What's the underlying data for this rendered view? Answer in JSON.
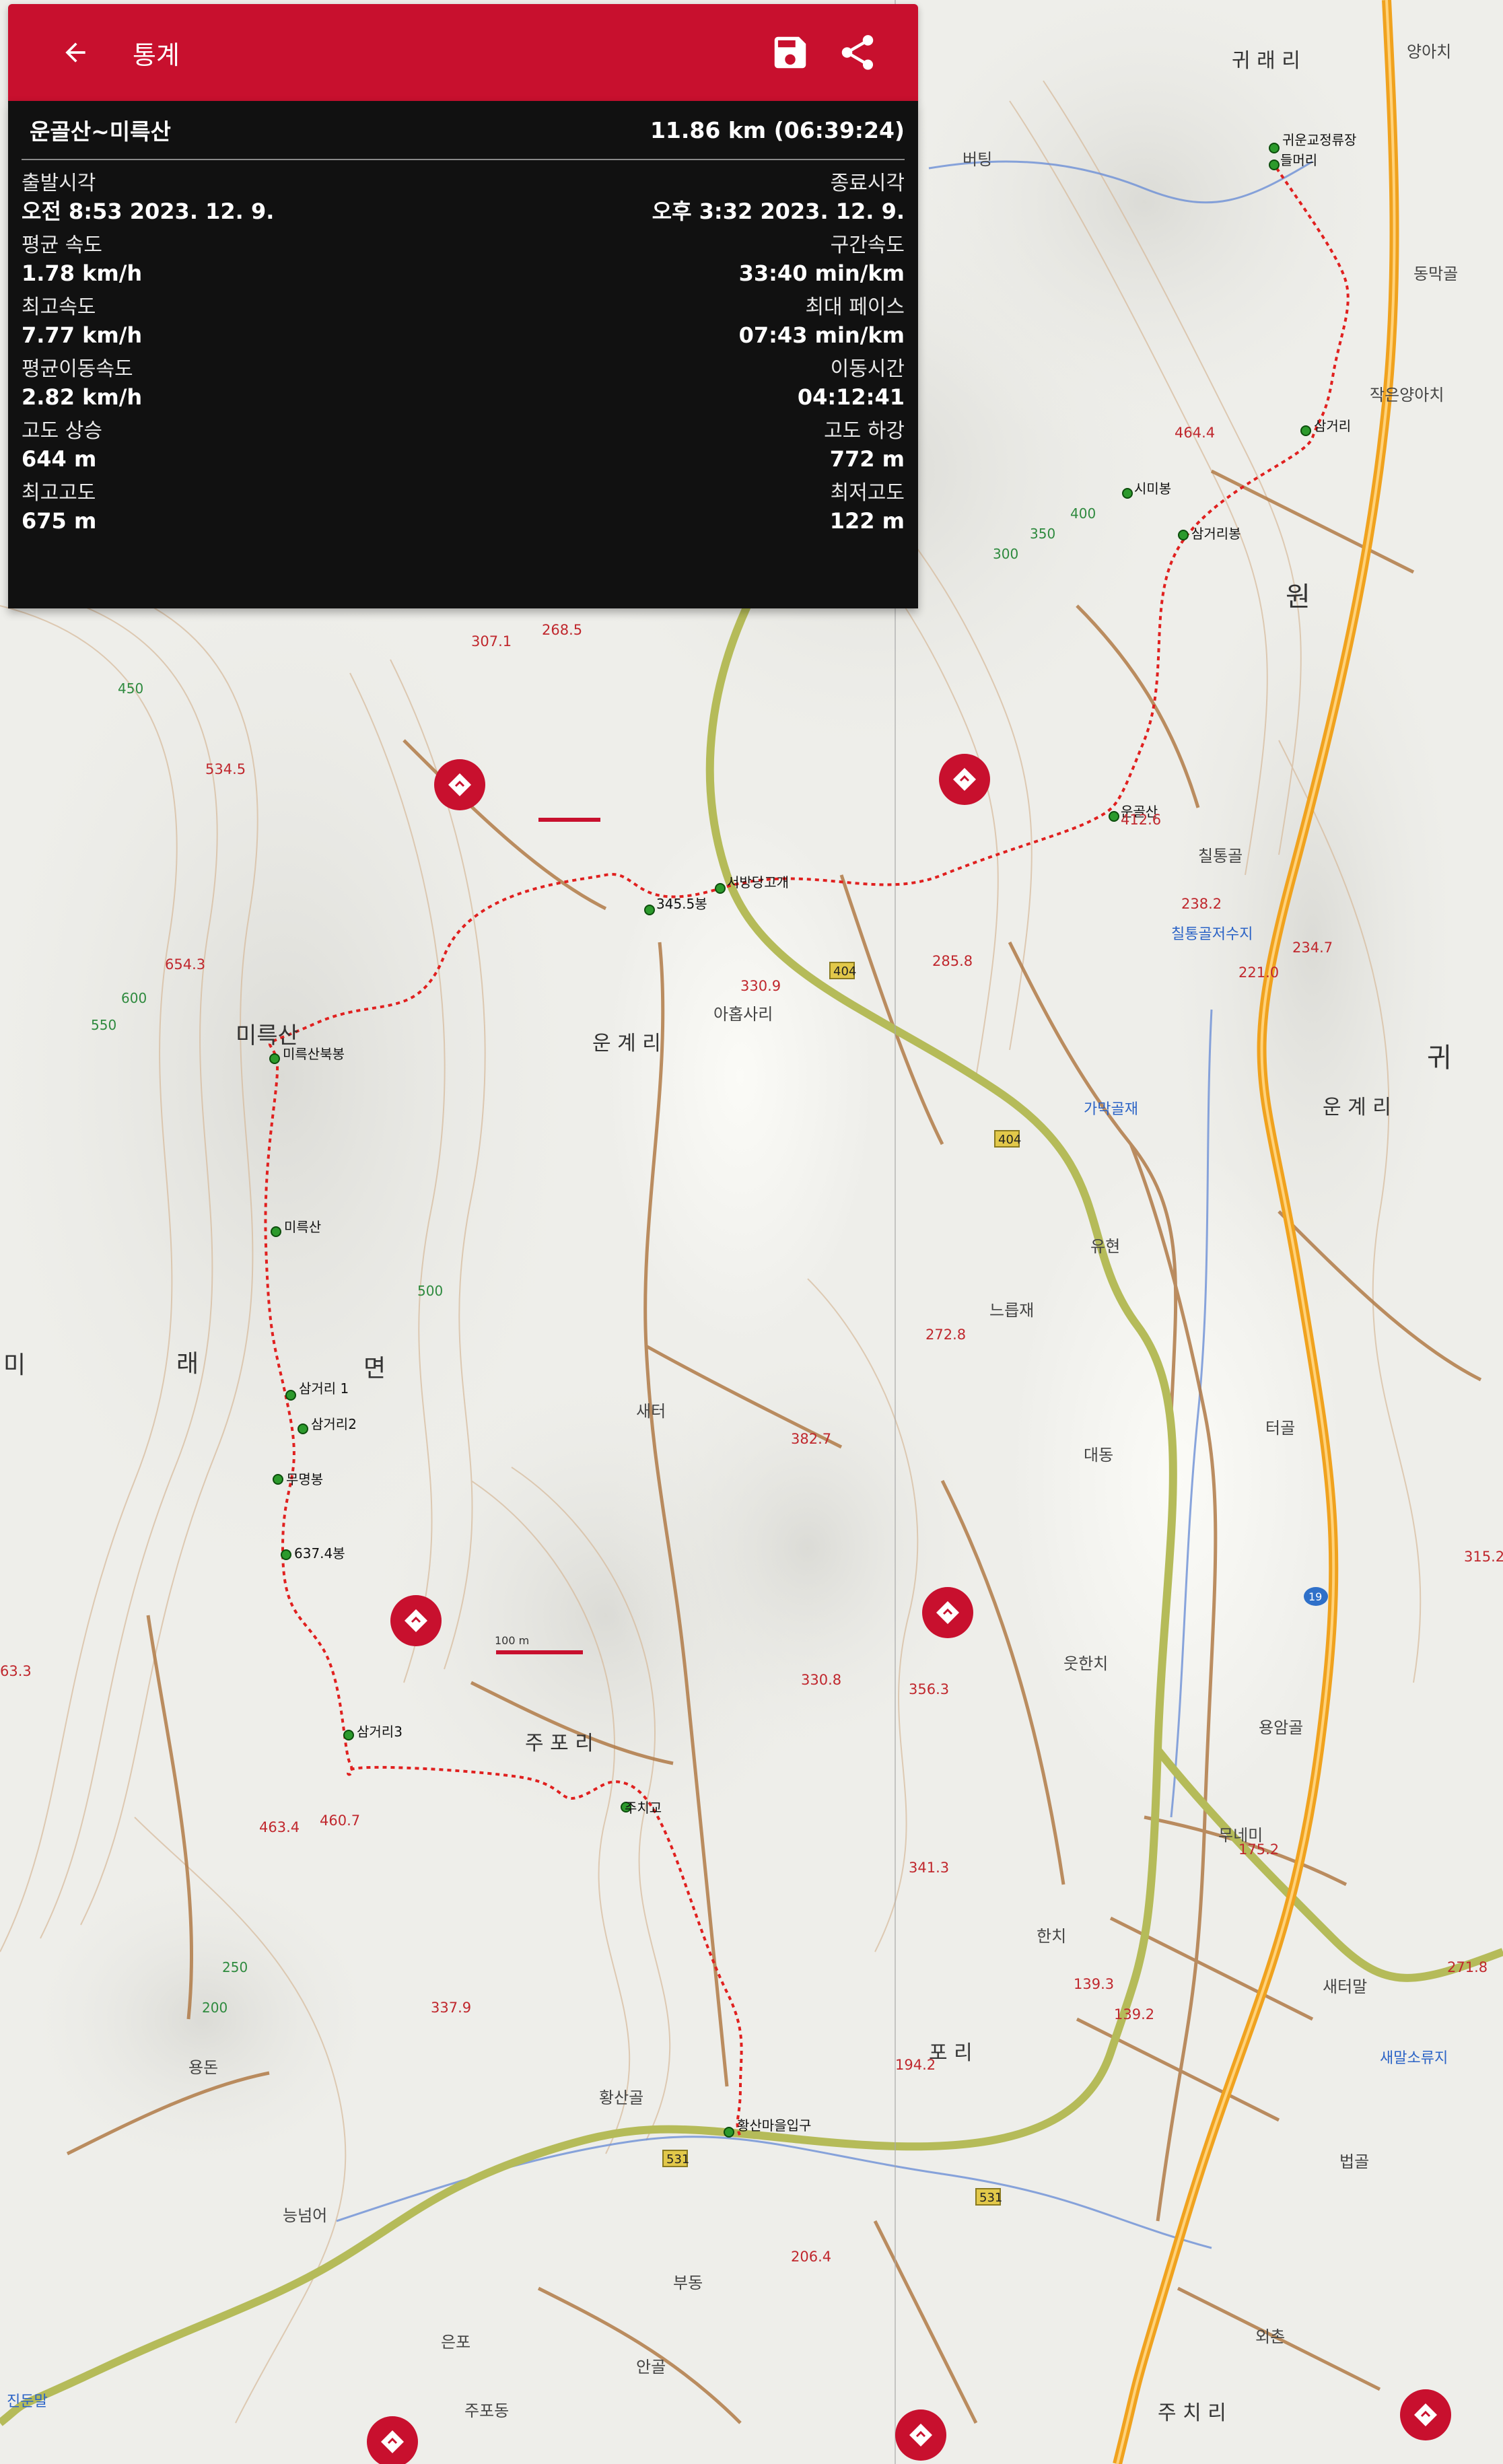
{
  "app_bar": {
    "title": "통계",
    "back_icon": "arrow-left-icon",
    "save_icon": "floppy-save-icon",
    "share_icon": "share-icon",
    "color": "#c8102e"
  },
  "stats": {
    "route_name": "운골산~미륵산",
    "summary": "11.86 km (06:39:24)",
    "rows": [
      {
        "left": {
          "label": "출발시각",
          "value": "오전 8:53 2023. 12. 9."
        },
        "right": {
          "label": "종료시각",
          "value": "오후 3:32 2023. 12. 9."
        }
      },
      {
        "left": {
          "label": "평균 속도",
          "value": "1.78 km/h"
        },
        "right": {
          "label": "구간속도",
          "value": "33:40 min/km"
        }
      },
      {
        "left": {
          "label": "최고속도",
          "value": "7.77 km/h"
        },
        "right": {
          "label": "최대 페이스",
          "value": "07:43 min/km"
        }
      },
      {
        "left": {
          "label": "평균이동속도",
          "value": "2.82 km/h"
        },
        "right": {
          "label": "이동시간",
          "value": "04:12:41"
        }
      },
      {
        "left": {
          "label": "고도 상승",
          "value": "644 m"
        },
        "right": {
          "label": "고도 하강",
          "value": "772 m"
        }
      },
      {
        "left": {
          "label": "최고고도",
          "value": "675 m"
        },
        "right": {
          "label": "최저고도",
          "value": "122 m"
        }
      }
    ]
  },
  "map": {
    "track_color": "#e0201f",
    "waypoints": [
      {
        "label": "귀운교정류장"
      },
      {
        "label": "들머리"
      },
      {
        "label": "삼거리"
      },
      {
        "label": "시미봉"
      },
      {
        "label": "삼거리봉"
      },
      {
        "label": "운골산"
      },
      {
        "label": "서방당고개"
      },
      {
        "label": "345.5봉"
      },
      {
        "label": "미륵산북봉"
      },
      {
        "label": "미륵산"
      },
      {
        "label": "삼거리 1"
      },
      {
        "label": "삼거리2"
      },
      {
        "label": "무명봉"
      },
      {
        "label": "637.4봉"
      },
      {
        "label": "삼거리3"
      },
      {
        "label": "주치교"
      },
      {
        "label": "황산마을입구"
      }
    ],
    "place_labels": {
      "mireuksan": "미륵산",
      "ungyeri_w": "운 계 리",
      "ungyeri_e": "운 계 리",
      "gwiraeri": "귀 래 리",
      "jupori": "주 포 리",
      "pori": "포 리",
      "myeon": "면",
      "rae": "래",
      "mi": "미",
      "won": "원",
      "gwi": "귀",
      "jucheori": "주 치 리",
      "yangahchi": "양아치",
      "beoting": "버팅",
      "dongmakgol": "동막골",
      "jageunyangahchi": "작은양아치",
      "chiltonggol": "칠통골",
      "saetteo": "새터",
      "yuhyeon": "유현",
      "neureumjae": "느릅재",
      "daedong": "대동",
      "teogol": "터골",
      "yongamgol": "용암골",
      "hanchi": "한치",
      "yongdon": "용돈",
      "neungneomeo": "능넘어",
      "eunpo": "은포",
      "ahngol": "안골",
      "hwangsangol": "황산골",
      "utanchi": "웃한치",
      "mune": "무네미",
      "saeteomal": "새터말",
      "beopgol": "법골",
      "oechon": "외촌",
      "chiltongjeosuji": "칠통골저수지",
      "gamakjae": "가막골재",
      "saemalsoryuji": "새말소류지",
      "jindunmal": "진둔말",
      "achisari": "아홉사리",
      "buchon": "부동",
      "juwpodong": "주포동"
    },
    "elevations": [
      "464.4",
      "412.6",
      "307.1",
      "268.5",
      "534.5",
      "654.3",
      "330.9",
      "285.8",
      "238.2",
      "234.7",
      "221.0",
      "272.8",
      "382.7",
      "330.8",
      "356.3",
      "341.3",
      "175.2",
      "139.3",
      "139.2",
      "337.9",
      "194.2",
      "206.4",
      "460.7",
      "463.4",
      "271.8",
      "315.2",
      "63.3"
    ],
    "contours": [
      "400",
      "350",
      "300",
      "450",
      "600",
      "550",
      "500",
      "250",
      "200"
    ],
    "road_numbers": [
      "404",
      "404",
      "531",
      "531",
      "19"
    ],
    "scale_label": "100 m"
  }
}
